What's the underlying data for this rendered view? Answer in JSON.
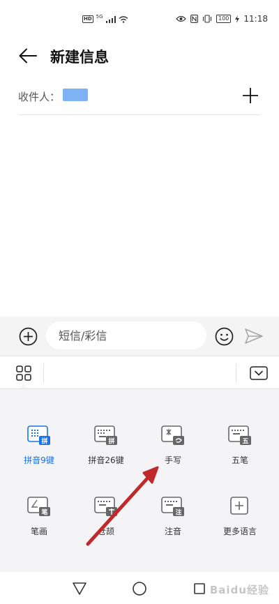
{
  "status_bar": {
    "hd_badge": "HD",
    "network": "5G",
    "battery": "100",
    "time": "11:18"
  },
  "header": {
    "title": "新建信息"
  },
  "recipient": {
    "label": "收件人："
  },
  "compose": {
    "placeholder": "短信/彩信"
  },
  "input_methods": [
    {
      "label": "拼音9键",
      "badge": "拼",
      "active": true
    },
    {
      "label": "拼音26键",
      "badge": "拼",
      "active": false
    },
    {
      "label": "手写",
      "badge": "",
      "active": false
    },
    {
      "label": "五笔",
      "badge": "五",
      "active": false
    },
    {
      "label": "笔画",
      "badge": "笔",
      "active": false
    },
    {
      "label": "仓颉",
      "badge": "",
      "active": false
    },
    {
      "label": "注音",
      "badge": "注",
      "active": false
    },
    {
      "label": "更多语言",
      "badge": "",
      "active": false
    }
  ],
  "colors": {
    "accent": "#1a73e8",
    "annotation_arrow": "#c0282a",
    "icon_gray": "#666666"
  },
  "watermark": {
    "text": "Baidu经验"
  }
}
